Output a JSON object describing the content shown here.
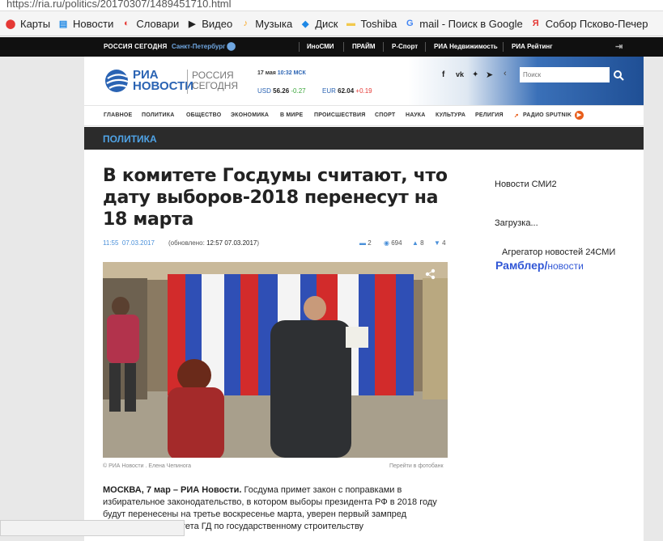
{
  "browser": {
    "url": "https://ria.ru/politics/20170307/1489451710.html",
    "bookmarks": [
      {
        "label": "Карты",
        "icon": "map-pin-icon",
        "color": "#e53935"
      },
      {
        "label": "Новости",
        "icon": "news-icon",
        "color": "#1e88e5"
      },
      {
        "label": "Словари",
        "icon": "dictionary-icon",
        "color": "#e53935"
      },
      {
        "label": "Видео",
        "icon": "video-icon",
        "color": "#222222"
      },
      {
        "label": "Музыка",
        "icon": "music-icon",
        "color": "#f9a825"
      },
      {
        "label": "Диск",
        "icon": "disk-icon",
        "color": "#1e88e5"
      },
      {
        "label": "Toshiba",
        "icon": "folder-icon",
        "color": "#f2c94c"
      },
      {
        "label": "mail - Поиск в Google",
        "icon": "google-icon",
        "color": "#4285f4"
      },
      {
        "label": "Собор Псково-Печер",
        "icon": "yandex-icon",
        "color": "#e53935"
      }
    ]
  },
  "topbar": {
    "logo": "РОССИЯ СЕГОДНЯ",
    "city": "Санкт-Петербург",
    "links": [
      "ИноСМИ",
      "ПРАЙМ",
      "Р-Спорт",
      "РИА Недвижимость",
      "РИА Рейтинг"
    ]
  },
  "header": {
    "logo_line1": "РИА",
    "logo_line2": "НОВОСТИ",
    "logo_sub1": "РОССИЯ",
    "logo_sub2": "СЕГОДНЯ",
    "date": "17 мая",
    "time": "10:32 МСК",
    "usd_label": "USD",
    "usd_value": "56.26",
    "usd_change": "-0.27",
    "eur_label": "EUR",
    "eur_value": "62.04",
    "eur_change": "+0.19",
    "search_placeholder": "Поиск"
  },
  "nav": [
    "ГЛАВНОЕ",
    "ПОЛИТИКА",
    "ОБЩЕСТВО",
    "ЭКОНОМИКА",
    "В МИРЕ",
    "ПРОИСШЕСТВИЯ",
    "СПОРТ",
    "НАУКА",
    "КУЛЬТУРА",
    "РЕЛИГИЯ",
    "РАДИО SPUTNIK"
  ],
  "section": "ПОЛИТИКА",
  "article": {
    "title": "В комитете Госдумы считают, что дату выборов-2018 перенесут на 18 марта",
    "time": "11:55",
    "date": "07.03.2017",
    "updated_label": "(обновлено:",
    "updated": "12:57 07.03.2017",
    "comments": "2",
    "views": "694",
    "likes": "8",
    "dislikes": "4",
    "photo_credit": "© РИА Новости . Елена Чепинога",
    "photobank_link": "Перейти в фотобанк",
    "lead_bold": "МОСКВА, 7 мар – РИА Новости.",
    "lead": "Госдума примет закон с поправками в избирательное законодательство, в котором выборы президента РФ в 2018 году будут перенесены на третье воскресенье марта, уверен первый зампред",
    "lead_cut": "тета ГД по государственному строительству"
  },
  "sidebar": {
    "smi2": "Новости СМИ2",
    "loading": "Загрузка...",
    "aggregator": "Агрегатор новостей 24СМИ",
    "rambler": "Рамблер/",
    "rambler_news": "новости"
  }
}
